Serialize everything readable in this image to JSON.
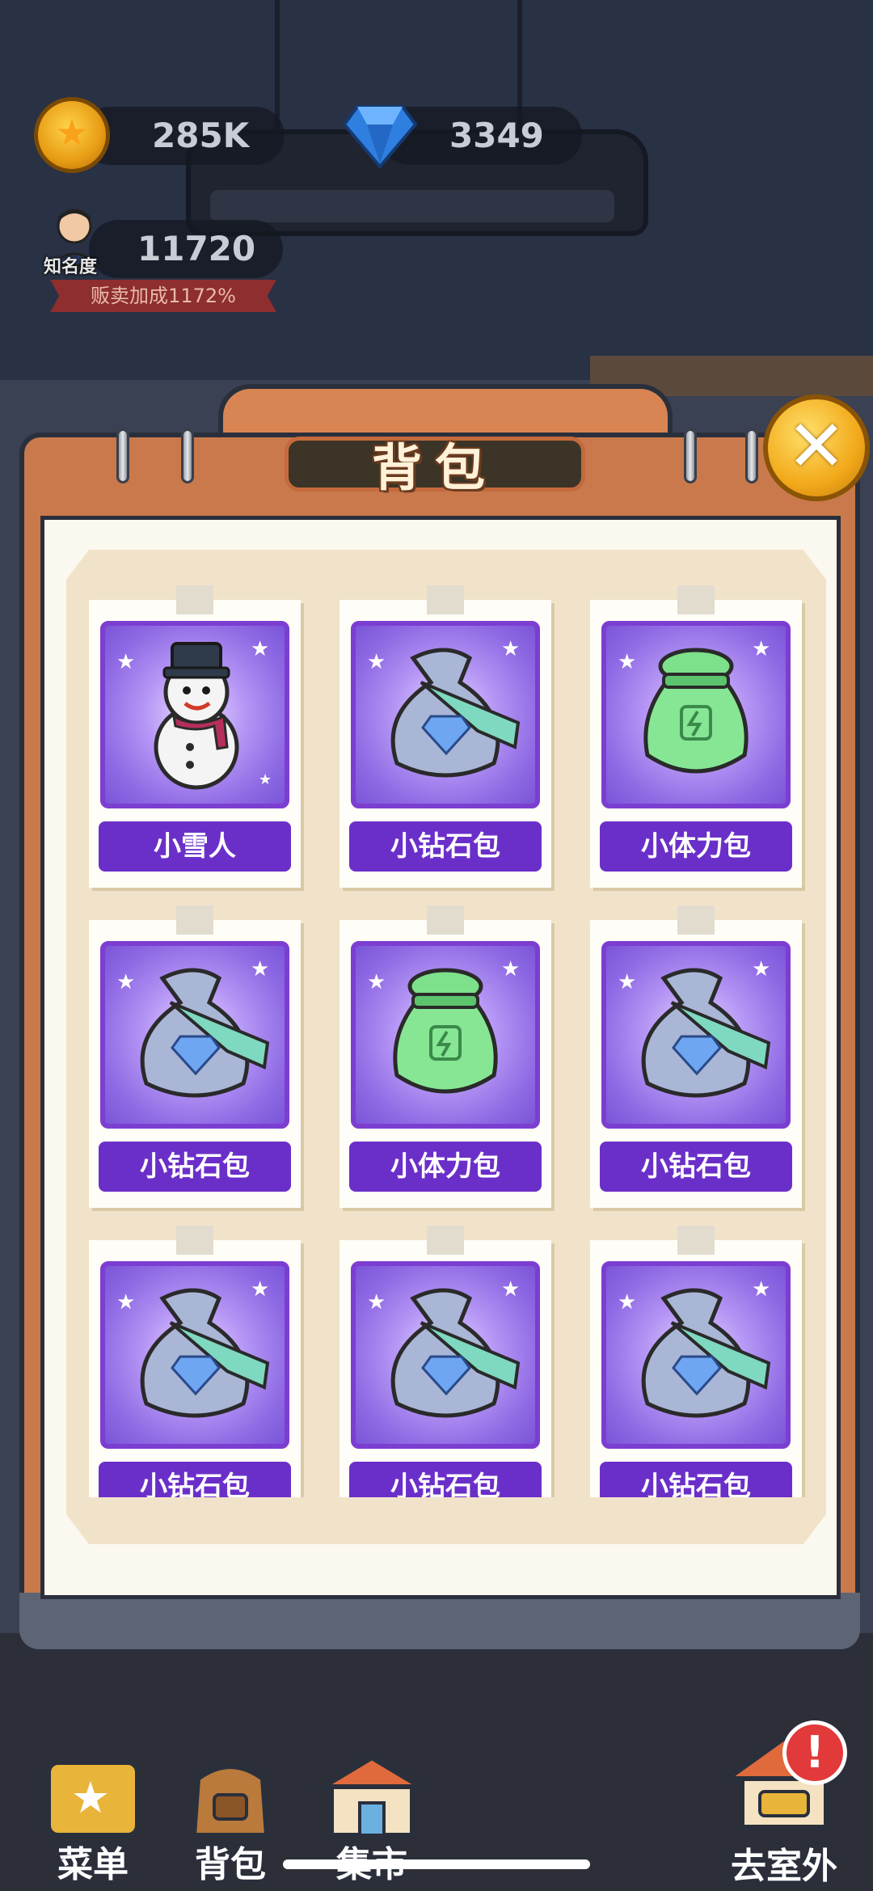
{
  "hud": {
    "coins": "285K",
    "gems": "3349",
    "fame_label": "知名度",
    "fame_value": "11720",
    "bonus_text": "贩卖加成1172%"
  },
  "panel": {
    "title": "背包",
    "close_icon": "close-icon"
  },
  "items": [
    {
      "label": "小雪人",
      "icon": "snowman-icon"
    },
    {
      "label": "小钻石包",
      "icon": "diamond-bag-icon"
    },
    {
      "label": "小体力包",
      "icon": "energy-bag-icon"
    },
    {
      "label": "小钻石包",
      "icon": "diamond-bag-icon"
    },
    {
      "label": "小体力包",
      "icon": "energy-bag-icon"
    },
    {
      "label": "小钻石包",
      "icon": "diamond-bag-icon"
    },
    {
      "label": "小钻石包",
      "icon": "diamond-bag-icon"
    },
    {
      "label": "小钻石包",
      "icon": "diamond-bag-icon"
    },
    {
      "label": "小钻石包",
      "icon": "diamond-bag-icon"
    }
  ],
  "bottom_nav": {
    "menu": "菜单",
    "bag": "背包",
    "market": "集市",
    "go_outside": "去室外",
    "alert": "!"
  },
  "colors": {
    "card_frame": "#7c3ed0",
    "label_bg": "#6b2fc9",
    "panel_orange": "#d88553"
  }
}
